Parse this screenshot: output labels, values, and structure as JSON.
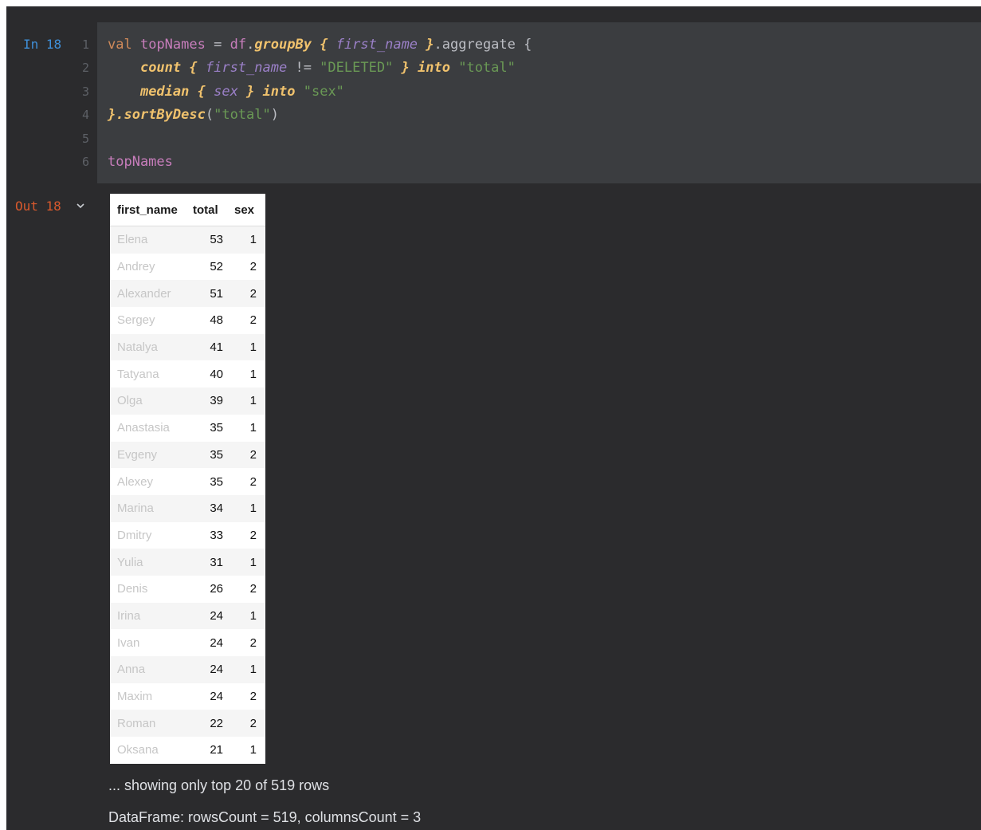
{
  "input_cell": {
    "prompt": "In 18",
    "line_numbers": [
      "1",
      "2",
      "3",
      "4",
      "5",
      "6"
    ],
    "code": {
      "l1_val": "val",
      "l1_name": "topNames",
      "l1_eq": " = ",
      "l1_df": "df",
      "l1_dot1": ".",
      "l1_groupby": "groupBy",
      "l1_brace_open": " { ",
      "l1_first_name": "first_name",
      "l1_brace_close": " }",
      "l1_aggregate": ".aggregate {",
      "l2_indent": "    ",
      "l2_count": "count",
      "l2_brace_open": " { ",
      "l2_first_name": "first_name",
      "l2_ne": " != ",
      "l2_deleted": "\"DELETED\"",
      "l2_brace_close": " } ",
      "l2_into": "into",
      "l2_space": " ",
      "l2_total": "\"total\"",
      "l3_indent": "    ",
      "l3_median": "median",
      "l3_brace_open": " { ",
      "l3_sex": "sex",
      "l3_brace_close": " } ",
      "l3_into": "into",
      "l3_space": " ",
      "l3_sex_str": "\"sex\"",
      "l4_close": "}.",
      "l4_sort": "sortByDesc",
      "l4_open_paren": "(",
      "l4_total": "\"total\"",
      "l4_close_paren": ")",
      "l6_topnames": "topNames"
    }
  },
  "output_cell": {
    "prompt": "Out 18",
    "icon": "chevron-down-icon",
    "table": {
      "headers": [
        "first_name",
        "total",
        "sex"
      ],
      "rows": [
        [
          "Elena",
          "53",
          "1"
        ],
        [
          "Andrey",
          "52",
          "2"
        ],
        [
          "Alexander",
          "51",
          "2"
        ],
        [
          "Sergey",
          "48",
          "2"
        ],
        [
          "Natalya",
          "41",
          "1"
        ],
        [
          "Tatyana",
          "40",
          "1"
        ],
        [
          "Olga",
          "39",
          "1"
        ],
        [
          "Anastasia",
          "35",
          "1"
        ],
        [
          "Evgeny",
          "35",
          "2"
        ],
        [
          "Alexey",
          "35",
          "2"
        ],
        [
          "Marina",
          "34",
          "1"
        ],
        [
          "Dmitry",
          "33",
          "2"
        ],
        [
          "Yulia",
          "31",
          "1"
        ],
        [
          "Denis",
          "26",
          "2"
        ],
        [
          "Irina",
          "24",
          "1"
        ],
        [
          "Ivan",
          "24",
          "2"
        ],
        [
          "Anna",
          "24",
          "1"
        ],
        [
          "Maxim",
          "24",
          "2"
        ],
        [
          "Roman",
          "22",
          "2"
        ],
        [
          "Oksana",
          "21",
          "1"
        ]
      ]
    },
    "showing_text": "... showing only top 20 of 519 rows",
    "summary_text": "DataFrame: rowsCount = 519, columnsCount = 3"
  },
  "colors": {
    "background": "#2b2b2d",
    "input_cell_bg": "#3b3d40",
    "in_prompt": "#3f8fd8",
    "out_prompt": "#d7592d"
  }
}
